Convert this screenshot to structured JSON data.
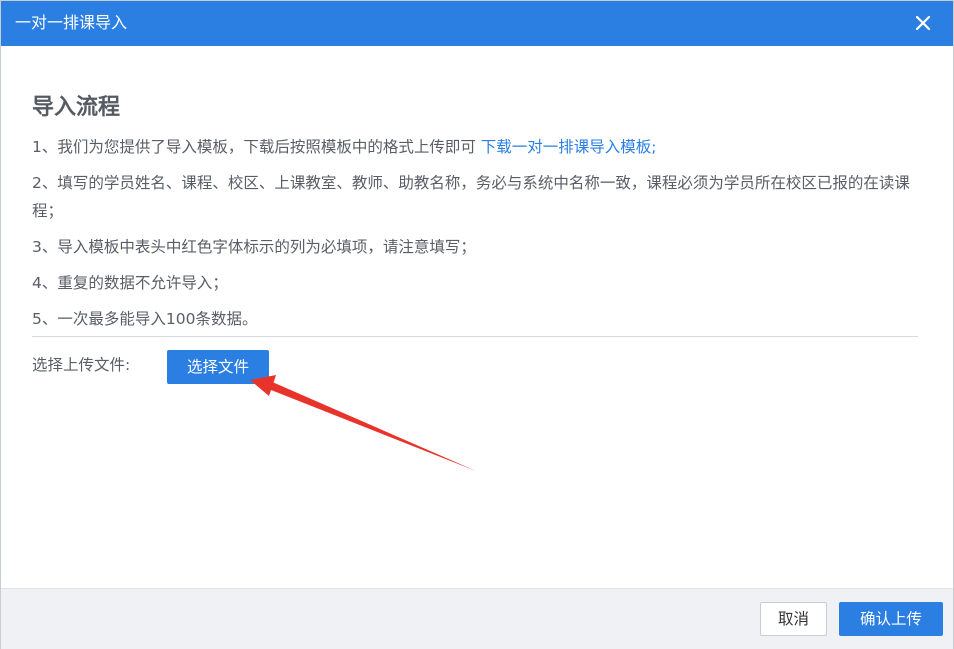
{
  "dialog": {
    "title": "一对一排课导入",
    "close_icon": "close-icon"
  },
  "guide": {
    "heading": "导入流程",
    "steps": [
      {
        "text": "1、我们为您提供了导入模板，下载后按照模板中的格式上传即可 ",
        "link": "下载一对一排课导入模板;"
      },
      {
        "text": "2、填写的学员姓名、课程、校区、上课教室、教师、助教名称，务必与系统中名称一致，课程必须为学员所在校区已报的在读课程；"
      },
      {
        "text": "3、导入模板中表头中红色字体标示的列为必填项，请注意填写；"
      },
      {
        "text": "4、重复的数据不允许导入；"
      },
      {
        "text": "5、一次最多能导入100条数据。"
      }
    ]
  },
  "upload": {
    "label": "选择上传文件:",
    "choose_button": "选择文件"
  },
  "footer": {
    "cancel_label": "取消",
    "confirm_label": "确认上传"
  },
  "colors": {
    "primary": "#2b7fe3",
    "annotation_arrow": "#e8332a"
  }
}
